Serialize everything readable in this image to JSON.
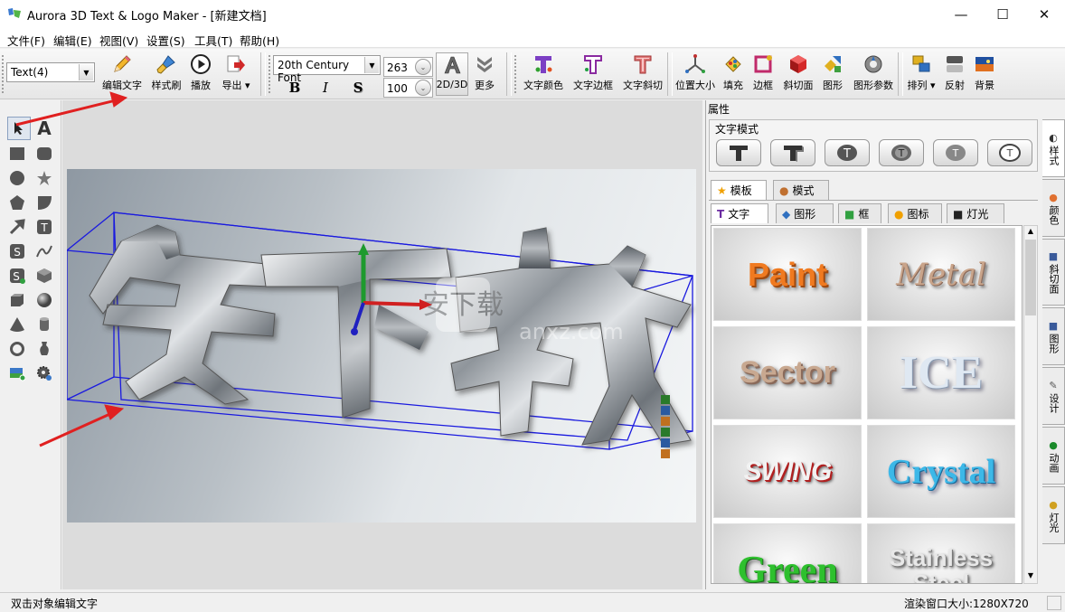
{
  "window": {
    "title": "Aurora 3D Text & Logo Maker - [新建文档]",
    "controls": {
      "minimize": "—",
      "maximize": "☐",
      "close": "✕"
    }
  },
  "menu": [
    "文件(F)",
    "编辑(E)",
    "视图(V)",
    "设置(S)",
    "工具(T)",
    "帮助(H)"
  ],
  "toolbar": {
    "object_select": "Text(4)",
    "edit_text": "编辑文字",
    "style_brush": "样式刷",
    "play": "播放",
    "export": "导出",
    "font_name": "20th Century Font",
    "bold": "B",
    "italic": "I",
    "shadow": "S",
    "size1": "263",
    "size2": "100",
    "mode_2d3d": "2D/3D",
    "more": "更多",
    "text_color": "文字颜色",
    "text_border": "文字边框",
    "text_bevel": "文字斜切",
    "position_size": "位置大小",
    "fill": "填充",
    "frame": "边框",
    "bevel_face": "斜切面",
    "shape": "图形",
    "shape_params": "图形参数",
    "arrange": "排列",
    "reflect": "反射",
    "background": "背景"
  },
  "canvas": {
    "text_3d": "安下载",
    "watermark": "安下载",
    "watermark_sub": "anxz.com"
  },
  "panel": {
    "title": "属性",
    "section_text_mode": "文字模式",
    "tabs_top": [
      "模板",
      "模式"
    ],
    "tabs_sub": [
      "文字",
      "图形",
      "框",
      "图标",
      "灯光"
    ],
    "thumbnails": [
      "Paint",
      "Metal",
      "Sector",
      "ICE",
      "SWING",
      "Crystal",
      "Green",
      "Stainless Steel"
    ]
  },
  "side_tabs": [
    "样式",
    "颜色",
    "斜切面",
    "图形",
    "设计",
    "动画",
    "灯光"
  ],
  "status": {
    "hint": "双击对象编辑文字",
    "render_size": "渲染窗口大小:1280X720"
  },
  "colors": {
    "accent_red": "#e02020",
    "bounding_box": "#1a1adf"
  }
}
